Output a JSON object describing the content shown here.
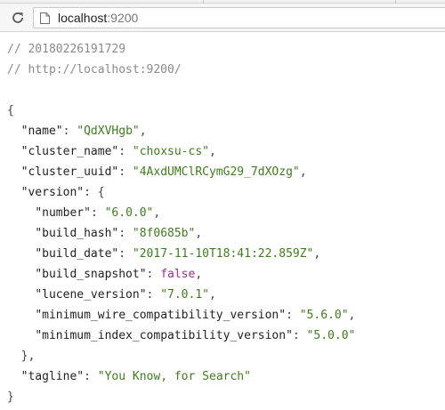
{
  "browser": {
    "url_host": "localhost",
    "url_port": ":9200",
    "reload_icon": "reload-icon",
    "page_icon": "page-icon"
  },
  "comments": {
    "timestamp": "// 20180226191729",
    "source_url": "// http://localhost:9200/"
  },
  "json": {
    "open_brace": "{",
    "close_brace": "}",
    "name_key": "\"name\"",
    "name_val": "\"QdXVHgb\"",
    "cluster_name_key": "\"cluster_name\"",
    "cluster_name_val": "\"choxsu-cs\"",
    "cluster_uuid_key": "\"cluster_uuid\"",
    "cluster_uuid_val": "\"4AxdUMClRCymG29_7dXOzg\"",
    "version_key": "\"version\"",
    "version_open": "{",
    "version_close": "},",
    "number_key": "\"number\"",
    "number_val": "\"6.0.0\"",
    "build_hash_key": "\"build_hash\"",
    "build_hash_val": "\"8f0685b\"",
    "build_date_key": "\"build_date\"",
    "build_date_val": "\"2017-11-10T18:41:22.859Z\"",
    "build_snapshot_key": "\"build_snapshot\"",
    "build_snapshot_val": "false",
    "lucene_version_key": "\"lucene_version\"",
    "lucene_version_val": "\"7.0.1\"",
    "min_wire_key": "\"minimum_wire_compatibility_version\"",
    "min_wire_val": "\"5.6.0\"",
    "min_index_key": "\"minimum_index_compatibility_version\"",
    "min_index_val": "\"5.0.0\"",
    "tagline_key": "\"tagline\"",
    "tagline_val": "\"You Know, for Search\""
  },
  "colors": {
    "string": "#3e7d1c",
    "boolean": "#9b2e8e",
    "comment": "#8a8a8a"
  }
}
